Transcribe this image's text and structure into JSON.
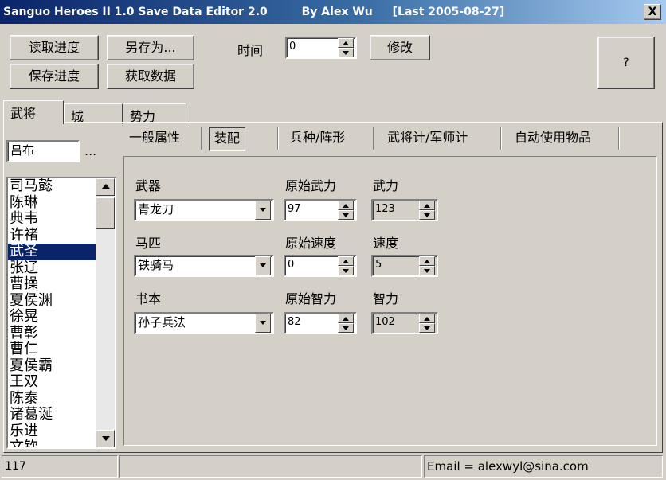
{
  "window": {
    "title": "Sanguo Heroes II 1.0 Save Data Editor 2.0",
    "author": "By Alex Wu",
    "last": "[Last 2005-08-27]",
    "close_label": "X"
  },
  "toolbar": {
    "load_label": "读取进度",
    "save_as_label": "另存为...",
    "save_label": "保存进度",
    "fetch_label": "获取数据",
    "time_label": "时间",
    "time_value": "0",
    "modify_label": "修改",
    "help_label": "?"
  },
  "tabs": [
    {
      "label": "武将",
      "active": true
    },
    {
      "label": "城",
      "active": false
    },
    {
      "label": "势力",
      "active": false
    }
  ],
  "general_name": "吕布",
  "ellipsis": "...",
  "subtabs": [
    {
      "label": "一般属性",
      "active": false
    },
    {
      "label": "装配",
      "active": true
    },
    {
      "label": "兵种/阵形",
      "active": false
    },
    {
      "label": "武将计/军师计",
      "active": false
    },
    {
      "label": "自动使用物品",
      "active": false
    }
  ],
  "general_list": {
    "items": [
      "司马懿",
      "陈琳",
      "典韦",
      "许褚",
      "武圣",
      "张辽",
      "曹操",
      "夏侯渊",
      "徐晃",
      "曹彰",
      "曹仁",
      "夏侯霸",
      "王双",
      "陈泰",
      "诸葛诞",
      "乐进",
      "文钦"
    ],
    "selected": "武圣"
  },
  "equip": {
    "weapon": {
      "label": "武器",
      "value": "青龙刀"
    },
    "orig_strength": {
      "label": "原始武力",
      "value": "97"
    },
    "strength": {
      "label": "武力",
      "value": "123"
    },
    "horse": {
      "label": "马匹",
      "value": "铁骑马"
    },
    "orig_speed": {
      "label": "原始速度",
      "value": "0"
    },
    "speed": {
      "label": "速度",
      "value": "5"
    },
    "book": {
      "label": "书本",
      "value": "孙子兵法"
    },
    "orig_intel": {
      "label": "原始智力",
      "value": "82"
    },
    "intel": {
      "label": "智力",
      "value": "102"
    }
  },
  "statusbar": {
    "count": "117",
    "middle": "",
    "email": "Email  =  alexwyl@sina.com"
  }
}
